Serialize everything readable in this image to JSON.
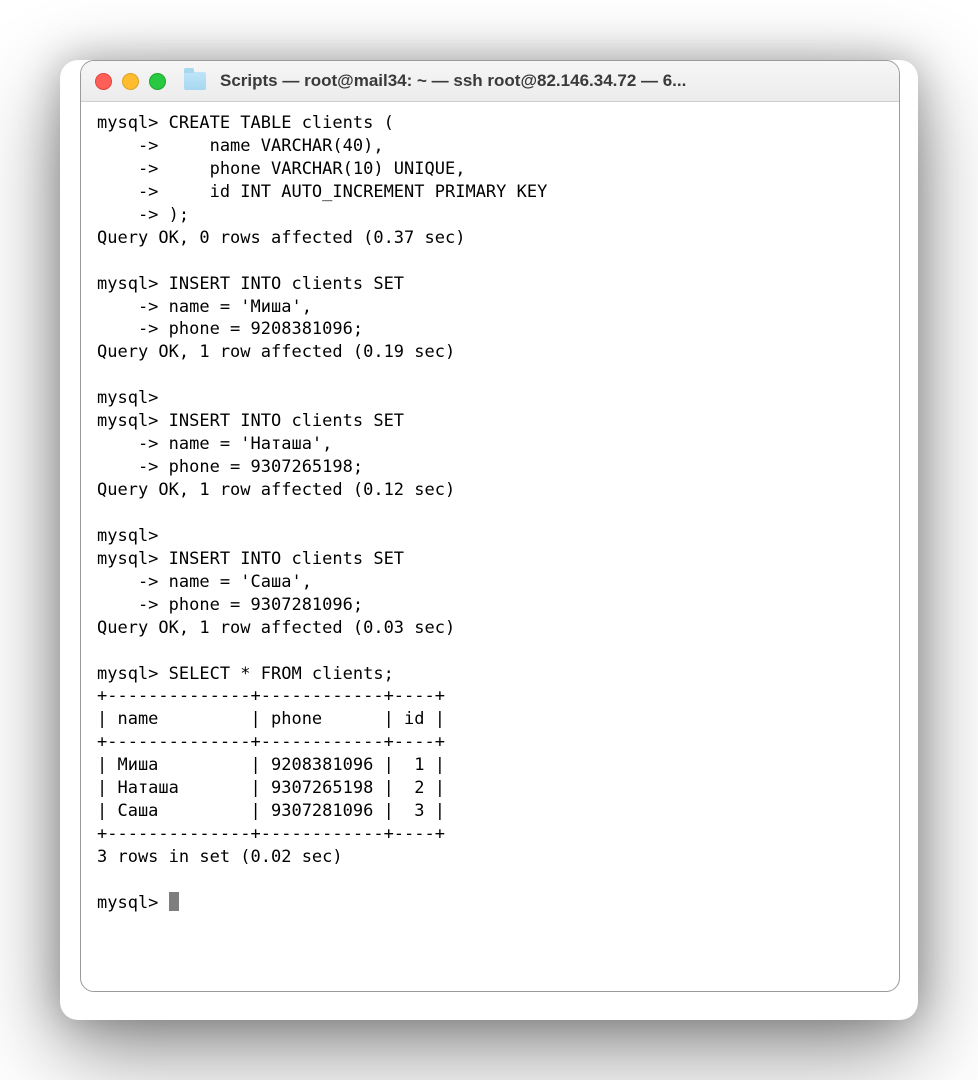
{
  "colors": {
    "red": "#ff5f57",
    "yellow": "#febc2e",
    "green": "#28c840",
    "folder": "#a6d8f0"
  },
  "title": "Scripts — root@mail34: ~ — ssh root@82.146.34.72 — 6...",
  "lines": [
    "mysql> CREATE TABLE clients (",
    "    ->     name VARCHAR(40),",
    "    ->     phone VARCHAR(10) UNIQUE,",
    "    ->     id INT AUTO_INCREMENT PRIMARY KEY",
    "    -> );",
    "Query OK, 0 rows affected (0.37 sec)",
    "",
    "mysql> INSERT INTO clients SET",
    "    -> name = 'Миша',",
    "    -> phone = 9208381096;",
    "Query OK, 1 row affected (0.19 sec)",
    "",
    "mysql>",
    "mysql> INSERT INTO clients SET",
    "    -> name = 'Наташа',",
    "    -> phone = 9307265198;",
    "Query OK, 1 row affected (0.12 sec)",
    "",
    "mysql>",
    "mysql> INSERT INTO clients SET",
    "    -> name = 'Саша',",
    "    -> phone = 9307281096;",
    "Query OK, 1 row affected (0.03 sec)",
    "",
    "mysql> SELECT * FROM clients;",
    "+--------------+------------+----+",
    "| name         | phone      | id |",
    "+--------------+------------+----+",
    "| Миша         | 9208381096 |  1 |",
    "| Наташа       | 9307265198 |  2 |",
    "| Саша         | 9307281096 |  3 |",
    "+--------------+------------+----+",
    "3 rows in set (0.02 sec)",
    ""
  ],
  "prompt": "mysql> "
}
